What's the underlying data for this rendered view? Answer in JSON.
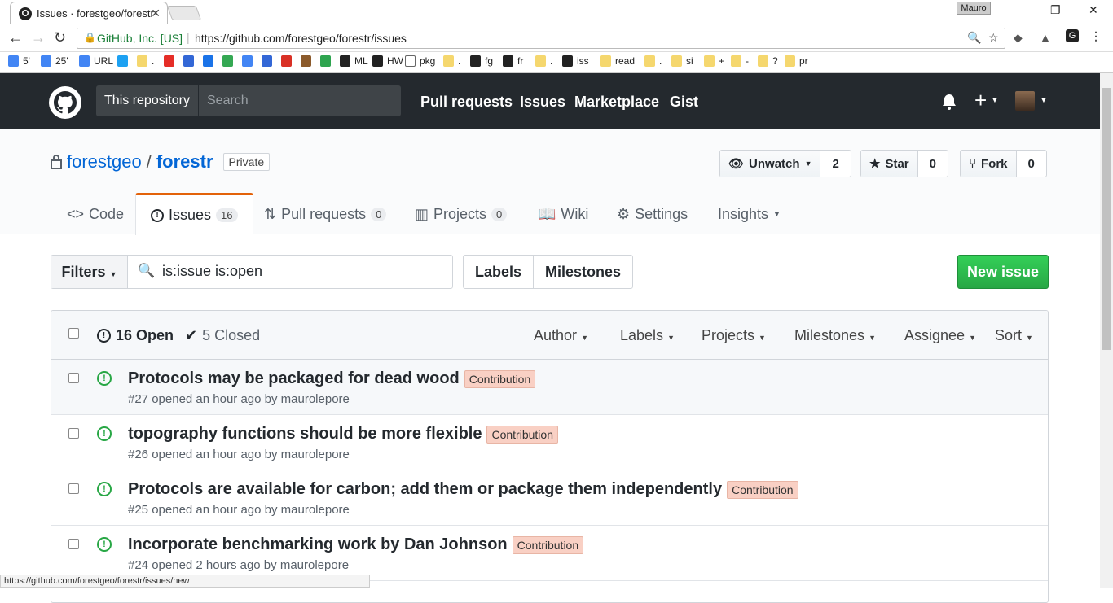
{
  "browser": {
    "tab_title": "Issues · forestgeo/forestr",
    "profile": "Mauro",
    "origin": "GitHub, Inc. [US]",
    "url": "https://github.com/forestgeo/forestr/issues",
    "status_url": "https://github.com/forestgeo/forestr/issues/new",
    "bookmarks": [
      {
        "label": "5'",
        "icon": "google-icon",
        "color": "#4285f4"
      },
      {
        "label": "25'",
        "icon": "google-icon",
        "color": "#4285f4"
      },
      {
        "label": "URL",
        "icon": "google-icon",
        "color": "#4285f4"
      },
      {
        "label": "",
        "icon": "twitter-icon",
        "color": "#1da1f2"
      },
      {
        "label": ".",
        "icon": "folder-icon",
        "color": "#f5d76e"
      },
      {
        "label": "",
        "icon": "youtube-icon",
        "color": "#e52d27"
      },
      {
        "label": "",
        "icon": "contacts-icon",
        "color": "#3367d6"
      },
      {
        "label": "",
        "icon": "calendar-icon",
        "color": "#1a73e8"
      },
      {
        "label": "",
        "icon": "maps-icon",
        "color": "#34a853"
      },
      {
        "label": "",
        "icon": "docs-icon",
        "color": "#4285f4"
      },
      {
        "label": "",
        "icon": "sites-icon",
        "color": "#3367d6"
      },
      {
        "label": "",
        "icon": "gmail-icon",
        "color": "#d93025"
      },
      {
        "label": "",
        "icon": "box-icon",
        "color": "#8b5a2b"
      },
      {
        "label": "",
        "icon": "github-icon",
        "color": "#2ea44f"
      },
      {
        "label": "ML",
        "icon": "github-icon",
        "color": "#222"
      },
      {
        "label": "HW",
        "icon": "github-icon",
        "color": "#222"
      },
      {
        "label": "pkg",
        "icon": "page-icon",
        "color": "#fff"
      },
      {
        "label": ".",
        "icon": "folder-icon",
        "color": "#f5d76e"
      },
      {
        "label": "fg",
        "icon": "github-icon",
        "color": "#222"
      },
      {
        "label": "fr",
        "icon": "github-icon",
        "color": "#222"
      },
      {
        "label": ".",
        "icon": "folder-icon",
        "color": "#f5d76e"
      },
      {
        "label": "iss",
        "icon": "github-icon",
        "color": "#222"
      },
      {
        "label": "read",
        "icon": "folder-icon",
        "color": "#f5d76e"
      },
      {
        "label": ".",
        "icon": "folder-icon",
        "color": "#f5d76e"
      },
      {
        "label": "si",
        "icon": "folder-icon",
        "color": "#f5d76e"
      },
      {
        "label": "+",
        "icon": "folder-icon",
        "color": "#f5d76e"
      },
      {
        "label": "-",
        "icon": "folder-icon",
        "color": "#f5d76e"
      },
      {
        "label": "?",
        "icon": "folder-icon",
        "color": "#f5d76e"
      },
      {
        "label": "pr",
        "icon": "folder-icon",
        "color": "#f5d76e"
      }
    ]
  },
  "header": {
    "scope": "This repository",
    "search_placeholder": "Search",
    "nav": [
      "Pull requests",
      "Issues",
      "Marketplace",
      "Gist"
    ]
  },
  "repo": {
    "owner": "forestgeo",
    "name": "forestr",
    "visibility": "Private",
    "unwatch_label": "Unwatch",
    "watch_count": "2",
    "star_label": "Star",
    "star_count": "0",
    "fork_label": "Fork",
    "fork_count": "0",
    "tabs": [
      {
        "label": "Code",
        "count": null
      },
      {
        "label": "Issues",
        "count": "16"
      },
      {
        "label": "Pull requests",
        "count": "0"
      },
      {
        "label": "Projects",
        "count": "0"
      },
      {
        "label": "Wiki",
        "count": null
      },
      {
        "label": "Settings",
        "count": null
      },
      {
        "label": "Insights",
        "count": null
      }
    ]
  },
  "subnav": {
    "filters_label": "Filters",
    "query": "is:issue is:open",
    "labels_label": "Labels",
    "milestones_label": "Milestones",
    "new_issue_label": "New issue"
  },
  "issues_header": {
    "open": "16 Open",
    "closed": "5 Closed",
    "menus": [
      "Author",
      "Labels",
      "Projects",
      "Milestones",
      "Assignee",
      "Sort"
    ]
  },
  "issues": [
    {
      "title": "Protocols may be packaged for dead wood",
      "label": "Contribution",
      "meta": "#27 opened an hour ago by maurolepore"
    },
    {
      "title": "topography functions should be more flexible",
      "label": "Contribution",
      "meta": "#26 opened an hour ago by maurolepore"
    },
    {
      "title": "Protocols are available for carbon; add them or package them independently",
      "label": "Contribution",
      "meta": "#25 opened an hour ago by maurolepore"
    },
    {
      "title": "Incorporate benchmarking work by Dan Johnson",
      "label": "Contribution",
      "meta": "#24 opened 2 hours ago by maurolepore"
    }
  ],
  "colors": {
    "accent": "#0366d6",
    "header_bg": "#24292e",
    "open_green": "#28a745",
    "label_bg": "#f9d0c4",
    "tab_accent": "#e36209"
  }
}
